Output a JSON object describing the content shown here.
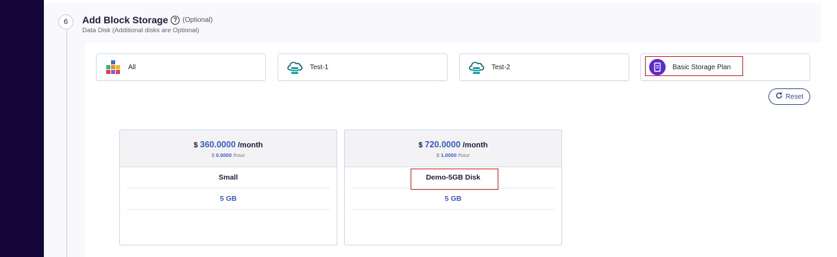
{
  "step": {
    "number": "6",
    "title": "Add Block Storage",
    "help_glyph": "?",
    "optional_tag": "(Optional)",
    "subtitle": "Data Disk (Additional disks are Optional)"
  },
  "categories": [
    {
      "label": "All",
      "icon": "puzzle-icon"
    },
    {
      "label": "Test-1",
      "icon": "cloud-storage-icon"
    },
    {
      "label": "Test-2",
      "icon": "cloud-storage-icon"
    },
    {
      "label": "Basic Storage Plan",
      "icon": "storage-plan-icon"
    }
  ],
  "reset": {
    "label": "Reset",
    "icon": "reset-icon"
  },
  "plans": [
    {
      "currency": "$",
      "monthly_amount": "360.0000",
      "monthly_unit": "/month",
      "hourly_currency": "$",
      "hourly_amount": "0.5000",
      "hourly_unit": "/hour",
      "name": "Small",
      "size": "5 GB"
    },
    {
      "currency": "$",
      "monthly_amount": "720.0000",
      "monthly_unit": "/month",
      "hourly_currency": "$",
      "hourly_amount": "1.0000",
      "hourly_unit": "/hour",
      "name": "Demo-5GB Disk",
      "size": "5 GB"
    }
  ],
  "colors": {
    "sidebar": "#15063a",
    "accent": "#3b5bbf",
    "highlight": "#cc1b1b"
  }
}
